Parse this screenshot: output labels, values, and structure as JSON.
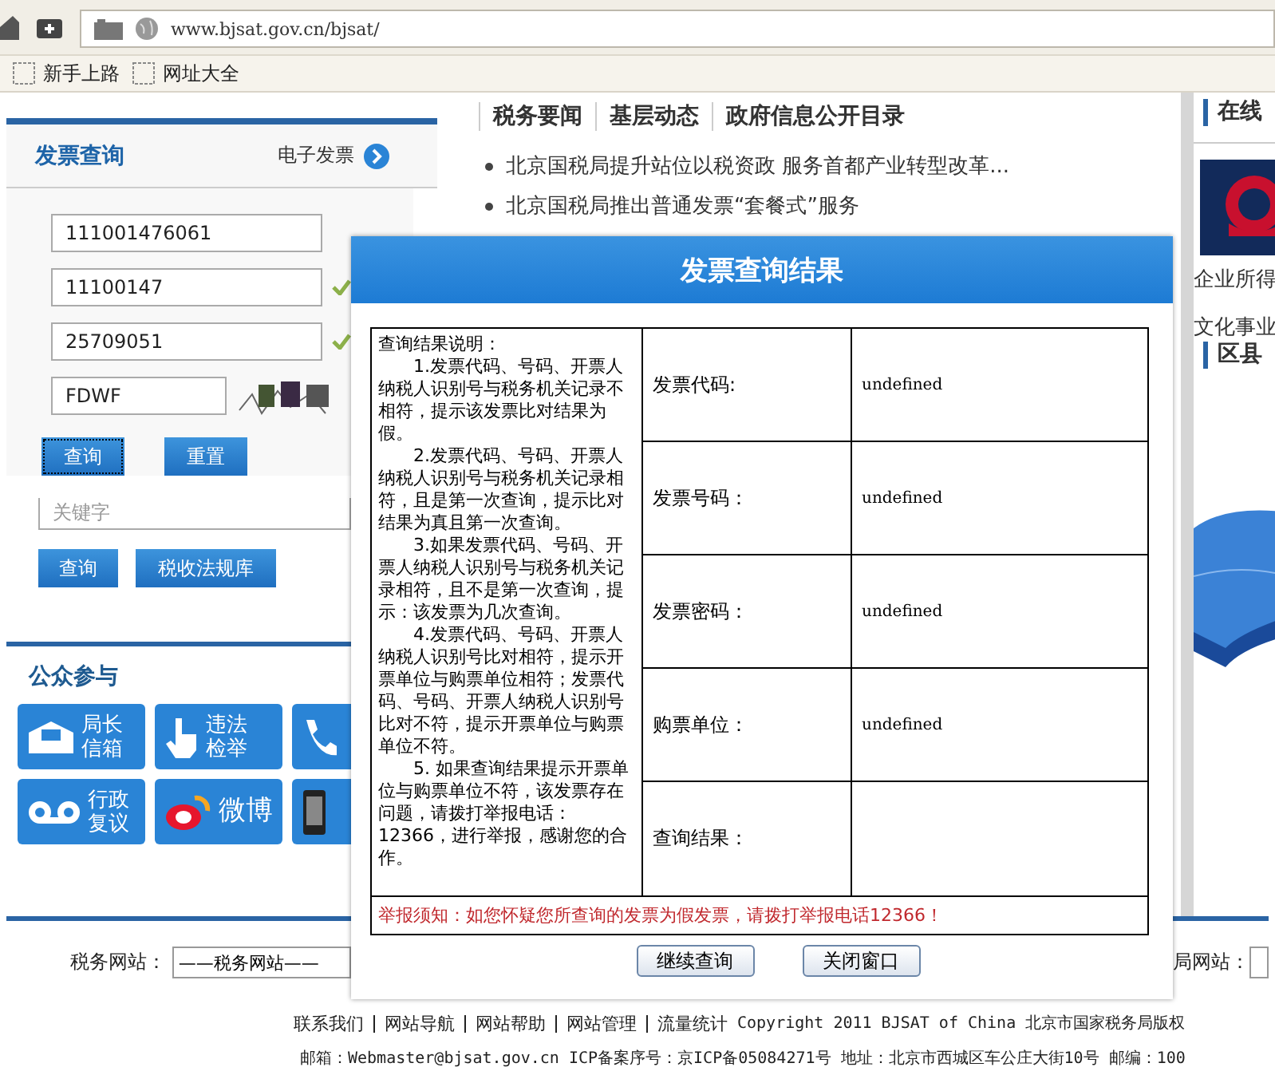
{
  "browser": {
    "url": "www.bjsat.gov.cn/bjsat/",
    "bookmarks": [
      "新手上路",
      "网址大全"
    ]
  },
  "invoice_query": {
    "title": "发票查询",
    "e_invoice_link": "电子发票",
    "fields": [
      {
        "kind": "text",
        "value": "111001476061",
        "verified": false
      },
      {
        "kind": "text",
        "value": "11100147",
        "verified": true
      },
      {
        "kind": "text",
        "value": "25709051",
        "verified": true
      },
      {
        "kind": "captcha",
        "value": "FDWF",
        "verified": false
      }
    ],
    "buttons": [
      {
        "label": "查询",
        "focused": true
      },
      {
        "label": "重置",
        "focused": false
      }
    ],
    "search_placeholder": "关键字",
    "search_buttons": [
      "查询",
      "税收法规库"
    ]
  },
  "public_participation": {
    "title": "公众参与",
    "tiles": [
      {
        "kind": "mail",
        "label": "局长信箱"
      },
      {
        "kind": "hand",
        "label": "违法检举"
      },
      {
        "kind": "phone"
      },
      {
        "kind": "voicemail",
        "label": "行政复议"
      },
      {
        "kind": "weibo",
        "label": "微博"
      },
      {
        "kind": "mobile"
      }
    ]
  },
  "news": {
    "tabs": [
      "税务要闻",
      "基层动态",
      "政府信息公开目录"
    ],
    "items": [
      "北京国税局提升站位以税资政 服务首都产业转型改革...",
      "北京国税局推出普通发票“套餐式”服务"
    ]
  },
  "right_column": {
    "heading": "在线",
    "captions": [
      "企业所得",
      "文化事业"
    ],
    "heading_2": "区县"
  },
  "footer": {
    "site_label": "税务网站：",
    "site_select": "——税务网站——",
    "right_label": "局网站：",
    "links": [
      "联系我们",
      "网站导航",
      "网站帮助",
      "网站管理",
      "流量统计"
    ],
    "copyright": "Copyright 2011 BJSAT of China 北京市国家税务局版权",
    "contact": "邮箱：Webmaster@bjsat.gov.cn ICP备案序号：京ICP备05084271号 地址：北京市西城区车公庄大街10号 邮编：100"
  },
  "dialog": {
    "title": "发票查询结果",
    "notes_title": "查询结果说明：",
    "notes": [
      "1.发票代码、号码、开票人纳税人识别号与税务机关记录不相符，提示该发票比对结果为假。",
      "2.发票代码、号码、开票人纳税人识别号与税务机关记录相符，且是第一次查询，提示比对结果为真且第一次查询。",
      "3.如果发票代码、号码、开票人纳税人识别号与税务机关记录相符，且不是第一次查询，提示：该发票为几次查询。",
      "4.发票代码、号码、开票人纳税人识别号比对相符，提示开票单位与购票单位相符；发票代码、号码、开票人纳税人识别号比对不符，提示开票单位与购票单位不符。",
      "5. 如果查询结果提示开票单位与购票单位不符，该发票存在问题，请拨打举报电话：12366，进行举报，感谢您的合作。"
    ],
    "rows": [
      {
        "label": "发票代码:",
        "value": "undefined"
      },
      {
        "label": "发票号码：",
        "value": "undefined"
      },
      {
        "label": "发票密码：",
        "value": "undefined"
      },
      {
        "label": "购票单位：",
        "value": "undefined"
      },
      {
        "label": "查询结果："
      }
    ],
    "warning": "举报须知：如您怀疑您所查询的发票为假发票，请拨打举报电话12366！",
    "buttons": [
      "继续查询",
      "关闭窗口"
    ]
  }
}
